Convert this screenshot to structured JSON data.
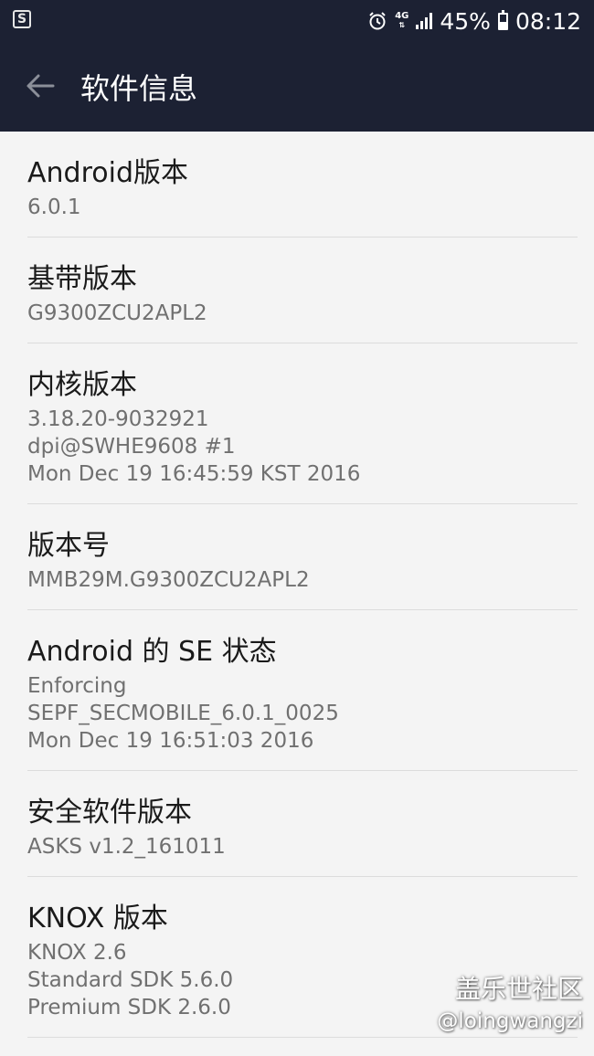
{
  "status_bar": {
    "network": "4G",
    "battery": "45%",
    "time": "08:12"
  },
  "app_bar": {
    "title": "软件信息"
  },
  "items": [
    {
      "label": "Android版本",
      "values": [
        "6.0.1"
      ]
    },
    {
      "label": "基带版本",
      "values": [
        "G9300ZCU2APL2"
      ]
    },
    {
      "label": "内核版本",
      "values": [
        "3.18.20-9032921",
        "dpi@SWHE9608 #1",
        "Mon Dec 19 16:45:59 KST 2016"
      ]
    },
    {
      "label": "版本号",
      "values": [
        "MMB29M.G9300ZCU2APL2"
      ]
    },
    {
      "label": "Android 的 SE 状态",
      "values": [
        "Enforcing",
        "SEPF_SECMOBILE_6.0.1_0025",
        "Mon Dec 19 16:51:03 2016"
      ]
    },
    {
      "label": "安全软件版本",
      "values": [
        "ASKS v1.2_161011"
      ]
    },
    {
      "label": "KNOX 版本",
      "values": [
        "KNOX 2.6",
        "Standard SDK 5.6.0",
        "Premium SDK 2.6.0"
      ]
    }
  ],
  "watermark": {
    "title": "盖乐世社区",
    "user": "@loingwangzi"
  }
}
